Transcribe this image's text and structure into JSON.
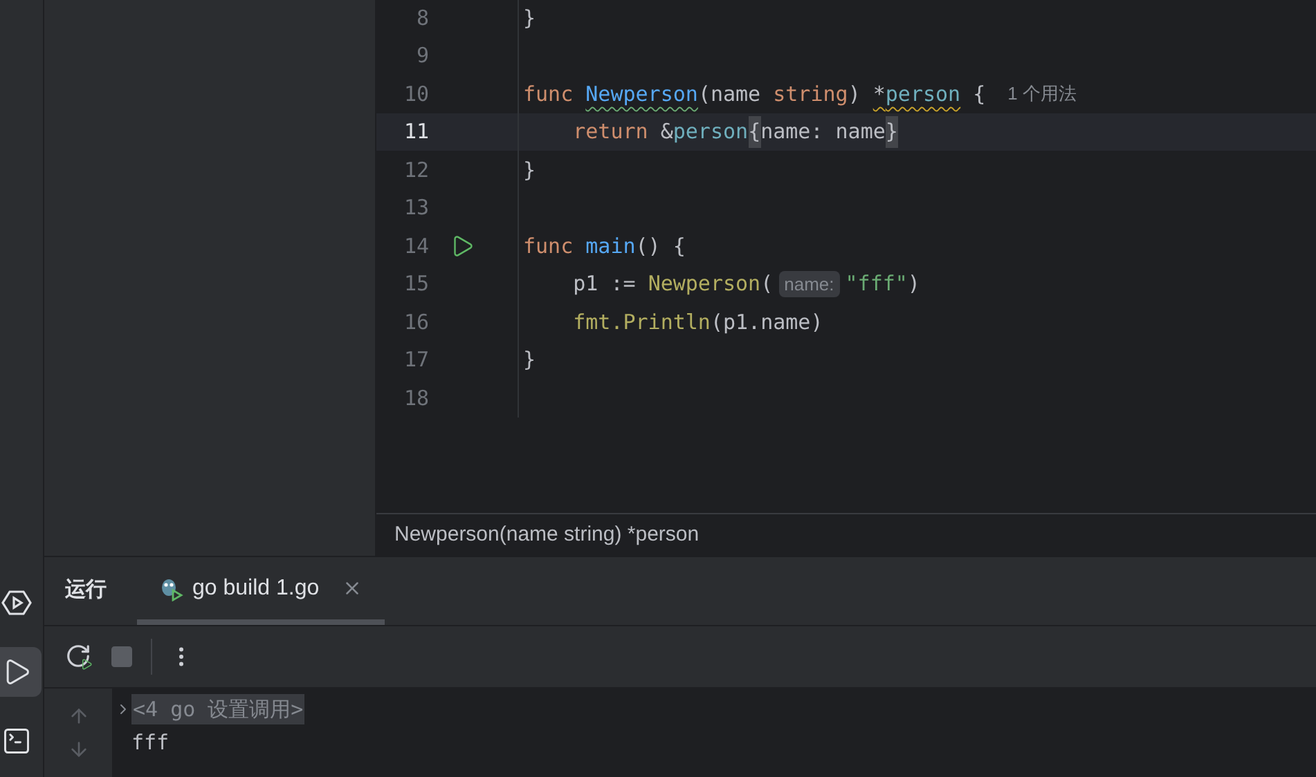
{
  "activity_bar": [
    {
      "kind": "services",
      "selected": false
    },
    {
      "kind": "run",
      "selected": true
    },
    {
      "kind": "terminal",
      "selected": false
    }
  ],
  "editor": {
    "lines": [
      {
        "number": "8",
        "current": false,
        "run_marker": false,
        "tokens": [
          {
            "kind": "plain",
            "text": "}"
          }
        ]
      },
      {
        "number": "9",
        "current": false,
        "run_marker": false
      },
      {
        "number": "10",
        "current": false,
        "run_marker": false,
        "tokens": [
          {
            "kind": "keyword",
            "text": "func "
          },
          {
            "kind": "func-typo",
            "text": "Newperson"
          },
          {
            "kind": "plain",
            "text": "(name "
          },
          {
            "kind": "keyword",
            "text": "string"
          },
          {
            "kind": "plain",
            "text": ") "
          },
          {
            "kind": "plain-warning",
            "text": "*"
          },
          {
            "kind": "type-warning",
            "text": "person"
          },
          {
            "kind": "plain",
            "text": " {"
          },
          {
            "kind": "usage",
            "text": "1 个用法"
          }
        ]
      },
      {
        "number": "11",
        "current": true,
        "run_marker": false,
        "tokens": [
          {
            "kind": "keyword",
            "text": "    return "
          },
          {
            "kind": "plain",
            "text": "&"
          },
          {
            "kind": "type",
            "text": "person"
          },
          {
            "kind": "brace-match",
            "text": "{"
          },
          {
            "kind": "plain",
            "text": "name: name"
          },
          {
            "kind": "brace-match",
            "text": "}"
          }
        ]
      },
      {
        "number": "12",
        "current": false,
        "run_marker": false,
        "tokens": [
          {
            "kind": "plain",
            "text": "}"
          }
        ]
      },
      {
        "number": "13",
        "current": false,
        "run_marker": false
      },
      {
        "number": "14",
        "current": false,
        "run_marker": true,
        "tokens": [
          {
            "kind": "keyword",
            "text": "func "
          },
          {
            "kind": "func",
            "text": "main"
          },
          {
            "kind": "plain",
            "text": "() {"
          }
        ]
      },
      {
        "number": "15",
        "current": false,
        "run_marker": false,
        "tokens": [
          {
            "kind": "plain",
            "text": "    p1 := "
          },
          {
            "kind": "call",
            "text": "Newperson"
          },
          {
            "kind": "plain",
            "text": "("
          },
          {
            "kind": "hint",
            "text": "name:"
          },
          {
            "kind": "string",
            "text": "\"fff\""
          },
          {
            "kind": "plain",
            "text": ")"
          }
        ]
      },
      {
        "number": "16",
        "current": false,
        "run_marker": false,
        "tokens": [
          {
            "kind": "call",
            "text": "    fmt.Println"
          },
          {
            "kind": "plain",
            "text": "(p1.name)"
          }
        ]
      },
      {
        "number": "17",
        "current": false,
        "run_marker": false,
        "tokens": [
          {
            "kind": "plain",
            "text": "}"
          }
        ]
      },
      {
        "number": "18",
        "current": false,
        "run_marker": false
      }
    ],
    "breadcrumb": "Newperson(name string) *person"
  },
  "run_panel": {
    "title": "运行",
    "tabs": [
      {
        "label": "go build 1.go",
        "selected": true
      }
    ],
    "console": [
      {
        "kind": "command",
        "text": "<4 go 设置调用>"
      },
      {
        "kind": "output",
        "text": "fff"
      }
    ]
  }
}
